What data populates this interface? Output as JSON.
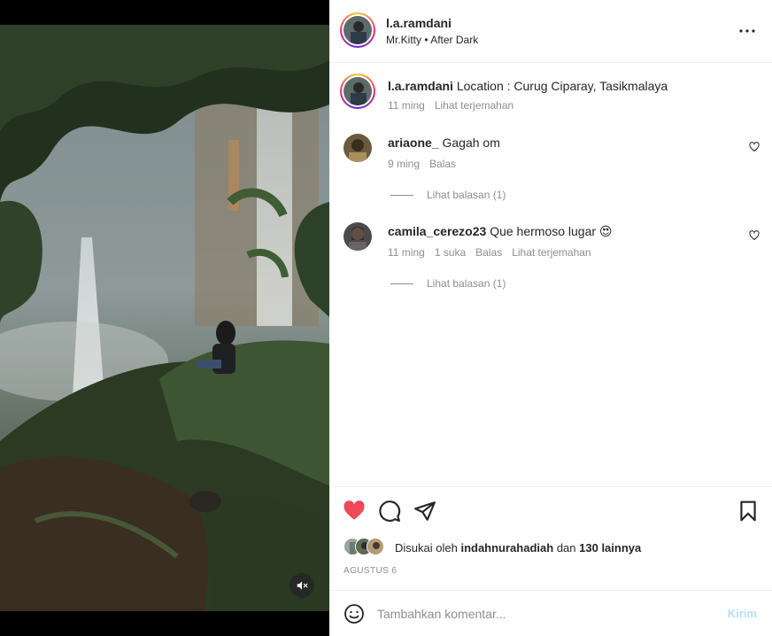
{
  "post": {
    "username": "l.a.ramdani",
    "audio": "Mr.Kitty • After Dark",
    "more_icon": "more-horizontal-icon"
  },
  "caption": {
    "username": "l.a.ramdani",
    "text": "Location : Curug Ciparay, Tasikmalaya",
    "time": "11 ming",
    "translate": "Lihat terjemahan"
  },
  "comments": [
    {
      "username": "ariaone_",
      "text": "Gagah om",
      "time": "9 ming",
      "reply": "Balas",
      "view_replies": "Lihat balasan (1)"
    },
    {
      "username": "camila_cerezo23",
      "text": "Que hermoso lugar 😍",
      "time": "11 ming",
      "likes": "1 suka",
      "reply": "Balas",
      "translate": "Lihat terjemahan",
      "view_replies": "Lihat balasan (1)"
    }
  ],
  "actions": {
    "like_icon": "heart-filled-icon",
    "comment_icon": "comment-icon",
    "share_icon": "send-icon",
    "save_icon": "bookmark-icon",
    "like_color": "#ed4956"
  },
  "likes": {
    "prefix": "Disukai oleh",
    "user": "indahnurahadiah",
    "joiner": "dan",
    "others": "130 lainnya"
  },
  "date": "AGUSTUS 6",
  "add_comment": {
    "placeholder": "Tambahkan komentar...",
    "post_label": "Kirim",
    "post_color": "#b2dffc"
  },
  "media": {
    "mute_icon": "speaker-muted-icon"
  }
}
